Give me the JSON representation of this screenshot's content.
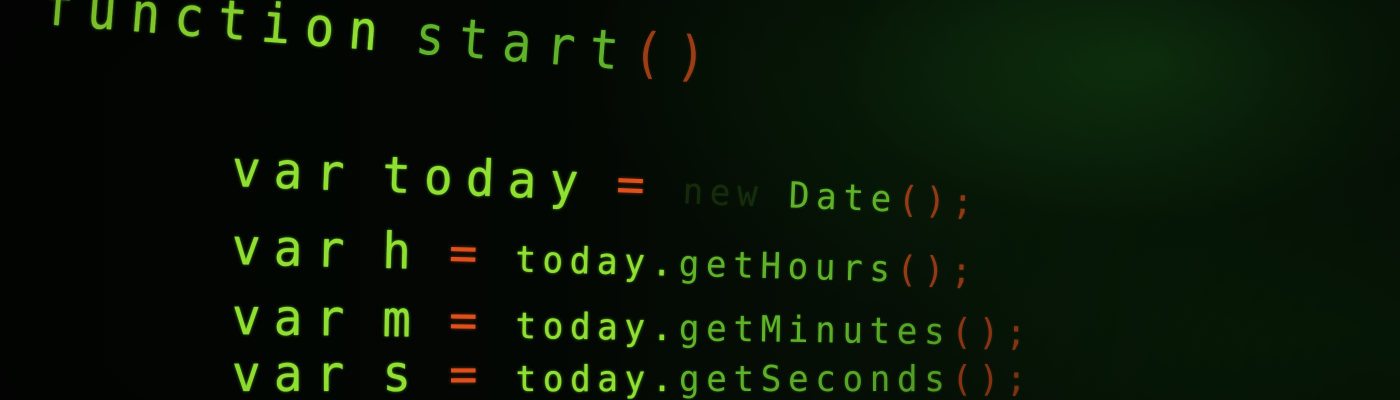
{
  "code_lines": [
    {
      "keyword": "function",
      "name": "start",
      "parens": "()"
    },
    {
      "keyword": "var",
      "name": "today",
      "op": "=",
      "faded": "new",
      "call": "Date",
      "parens": "()",
      "end": ";"
    },
    {
      "keyword": "var",
      "name": "h",
      "op": "=",
      "object": "today.",
      "method": "getHours",
      "parens": "()",
      "end": ";"
    },
    {
      "keyword": "var",
      "name": "m",
      "op": "=",
      "object": "today.",
      "method": "getMinutes",
      "parens": "()",
      "end": ";"
    },
    {
      "keyword": "var",
      "name": "s",
      "op": "=",
      "object": "today.",
      "method": "getSeconds",
      "parens": "()",
      "end": ";"
    }
  ],
  "colors": {
    "code_text": "#8fe030",
    "operator": "#e0501c",
    "background_glow": "#0a1d0a"
  }
}
